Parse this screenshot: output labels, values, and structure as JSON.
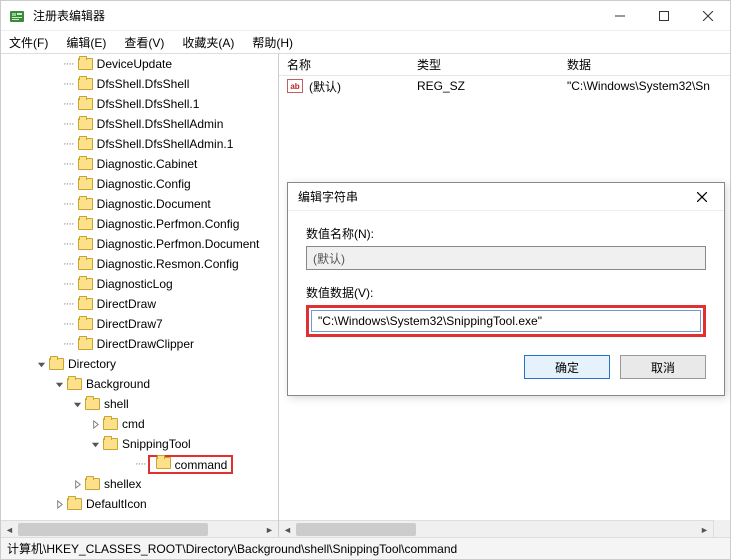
{
  "window": {
    "title": "注册表编辑器"
  },
  "menu": {
    "file": "文件(F)",
    "edit": "编辑(E)",
    "view": "查看(V)",
    "fav": "收藏夹(A)",
    "help": "帮助(H)"
  },
  "tree": {
    "items": [
      {
        "indent": 50,
        "toggle": "",
        "label": "DeviceUpdate"
      },
      {
        "indent": 50,
        "toggle": "",
        "label": "DfsShell.DfsShell"
      },
      {
        "indent": 50,
        "toggle": "",
        "label": "DfsShell.DfsShell.1"
      },
      {
        "indent": 50,
        "toggle": "",
        "label": "DfsShell.DfsShellAdmin"
      },
      {
        "indent": 50,
        "toggle": "",
        "label": "DfsShell.DfsShellAdmin.1"
      },
      {
        "indent": 50,
        "toggle": "",
        "label": "Diagnostic.Cabinet"
      },
      {
        "indent": 50,
        "toggle": "",
        "label": "Diagnostic.Config"
      },
      {
        "indent": 50,
        "toggle": "",
        "label": "Diagnostic.Document"
      },
      {
        "indent": 50,
        "toggle": "",
        "label": "Diagnostic.Perfmon.Config"
      },
      {
        "indent": 50,
        "toggle": "",
        "label": "Diagnostic.Perfmon.Document"
      },
      {
        "indent": 50,
        "toggle": "",
        "label": "Diagnostic.Resmon.Config"
      },
      {
        "indent": 50,
        "toggle": "",
        "label": "DiagnosticLog"
      },
      {
        "indent": 50,
        "toggle": "",
        "label": "DirectDraw"
      },
      {
        "indent": 50,
        "toggle": "",
        "label": "DirectDraw7"
      },
      {
        "indent": 50,
        "toggle": "",
        "label": "DirectDrawClipper"
      },
      {
        "indent": 34,
        "toggle": "v",
        "label": "Directory"
      },
      {
        "indent": 52,
        "toggle": "v",
        "label": "Background"
      },
      {
        "indent": 70,
        "toggle": "v",
        "label": "shell"
      },
      {
        "indent": 88,
        "toggle": ">",
        "label": "cmd"
      },
      {
        "indent": 88,
        "toggle": "v",
        "label": "SnippingTool"
      },
      {
        "indent": 122,
        "toggle": "",
        "label": "command",
        "selected": true
      },
      {
        "indent": 70,
        "toggle": ">",
        "label": "shellex"
      },
      {
        "indent": 52,
        "toggle": ">",
        "label": "DefaultIcon"
      }
    ]
  },
  "grid": {
    "headers": {
      "name": "名称",
      "type": "类型",
      "data": "数据"
    },
    "row": {
      "name": "(默认)",
      "type": "REG_SZ",
      "data": "\"C:\\Windows\\System32\\Sn"
    }
  },
  "dialog": {
    "title": "编辑字符串",
    "name_label": "数值名称(N):",
    "name_value": "(默认)",
    "data_label": "数值数据(V):",
    "data_value": "\"C:\\Windows\\System32\\SnippingTool.exe\"",
    "ok": "确定",
    "cancel": "取消"
  },
  "statusbar": {
    "path": "计算机\\HKEY_CLASSES_ROOT\\Directory\\Background\\shell\\SnippingTool\\command"
  }
}
